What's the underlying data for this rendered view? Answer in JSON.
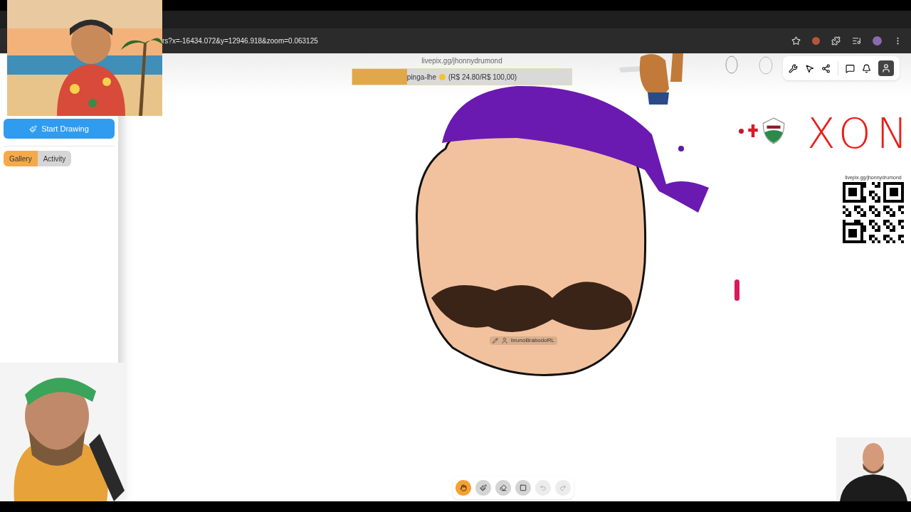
{
  "browser": {
    "url": "rs?x=-16434.072&y=12946.918&zoom=0.063125"
  },
  "sidebar": {
    "start_button": "Start Drawing",
    "tabs": [
      {
        "label": "Gallery",
        "selected": true
      },
      {
        "label": "Activity",
        "selected": false
      }
    ]
  },
  "canvas": {
    "goal": {
      "link": "livepix.gg/jhonnydrumond",
      "label": "pinga-lhe",
      "amount": "(R$ 24.80/R$ 100,00)",
      "level": 0.25
    },
    "qr": {
      "link": "livepix.gg/jhonnydrumond"
    },
    "scribble": "XON",
    "cursor_user": "brunoBrabodoRL"
  },
  "tools": [
    {
      "kind": "hand",
      "selected": true,
      "disabled": false
    },
    {
      "kind": "pen",
      "selected": false,
      "disabled": false
    },
    {
      "kind": "eraser",
      "selected": false,
      "disabled": false
    },
    {
      "kind": "rectangle",
      "selected": false,
      "disabled": false
    },
    {
      "kind": "undo",
      "selected": false,
      "disabled": true
    },
    {
      "kind": "redo",
      "selected": false,
      "disabled": true
    }
  ]
}
